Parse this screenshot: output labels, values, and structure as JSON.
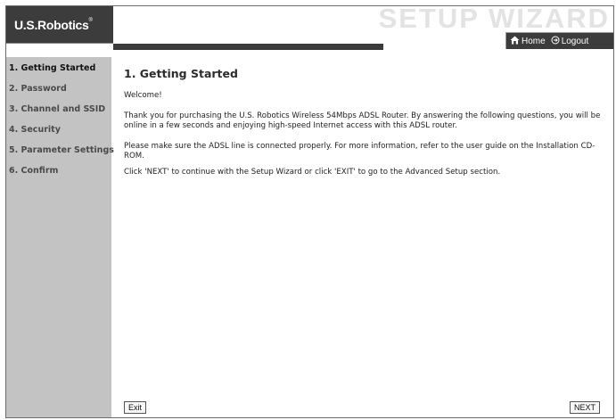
{
  "header": {
    "logo_text": "U.S.Robotics",
    "logo_mark": "®",
    "wizard_title": "SETUP WIZARD",
    "home_label": "Home",
    "logout_label": "Logout"
  },
  "sidebar": {
    "items": [
      {
        "label": "1. Getting Started",
        "active": true
      },
      {
        "label": "2. Password"
      },
      {
        "label": "3. Channel and SSID"
      },
      {
        "label": "4. Security"
      },
      {
        "label": "5. Parameter Settings"
      },
      {
        "label": "6. Confirm"
      }
    ]
  },
  "main": {
    "title": "1. Getting Started",
    "paragraphs": [
      "Welcome!",
      "Thank you for purchasing the U.S. Robotics Wireless 54Mbps ADSL Router. By answering the following questions, you will be online in a few seconds and enjoying high-speed Internet access with this ADSL router.",
      "Please make sure the ADSL line is connected properly. For more information, refer to the user guide on the Installation CD-ROM.",
      "Click 'NEXT' to continue with the Setup Wizard or click 'EXIT' to go to the Advanced Setup section."
    ]
  },
  "buttons": {
    "exit_label": "Exit",
    "next_label": "NEXT"
  },
  "colors": {
    "header_dark": "#3c3c3c",
    "sidebar_bg": "#c3c3c3",
    "title_watermark": "#e3e3e3"
  },
  "icons": {
    "home": "home-icon",
    "logout": "logout-icon"
  }
}
